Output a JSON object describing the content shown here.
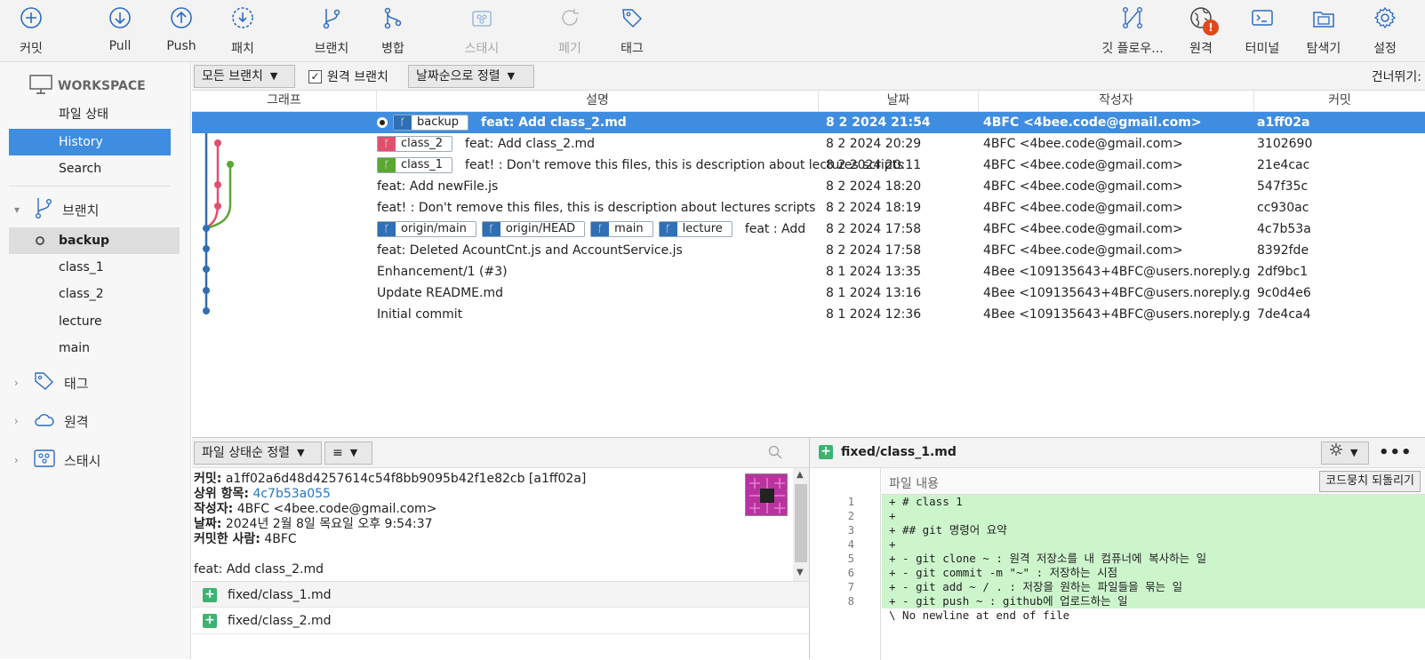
{
  "toolbar": {
    "commit": "커밋",
    "pull": "Pull",
    "push": "Push",
    "patch": "패치",
    "branch": "브랜치",
    "merge": "병합",
    "stash": "스태시",
    "discard": "폐기",
    "tag": "태그",
    "gitflow": "깃 플로우...",
    "remote": "원격",
    "terminal": "터미널",
    "explorer": "탐색기",
    "settings": "설정",
    "remote_badge": "!"
  },
  "sidebar": {
    "workspace": "WORKSPACE",
    "workspace_items": [
      "파일 상태",
      "History",
      "Search"
    ],
    "branches_label": "브랜치",
    "branches": [
      "backup",
      "class_1",
      "class_2",
      "lecture",
      "main"
    ],
    "tags_label": "태그",
    "remotes_label": "원격",
    "stashes_label": "스태시"
  },
  "filterbar": {
    "all_branches": "모든 브랜치",
    "remote_branches": "원격 브랜치",
    "sort_by_date": "날짜순으로 정렬",
    "skip": "건너뛰기:"
  },
  "table": {
    "headers": {
      "graph": "그래프",
      "description": "설명",
      "date": "날짜",
      "author": "작성자",
      "commit": "커밋"
    },
    "rows": [
      {
        "tags": [
          {
            "name": "backup",
            "color": "#2f6fb5"
          }
        ],
        "message": "feat: Add class_2.md",
        "date": "8 2 2024 21:54",
        "author": "4BFC <4bee.code@gmail.com>",
        "commit": "a1ff02a"
      },
      {
        "tags": [
          {
            "name": "class_2",
            "color": "#e0506e"
          }
        ],
        "message": "feat: Add class_2.md",
        "date": "8 2 2024 20:29",
        "author": "4BFC <4bee.code@gmail.com>",
        "commit": "3102690"
      },
      {
        "tags": [
          {
            "name": "class_1",
            "color": "#5aa832"
          }
        ],
        "message": "feat! : Don't remove this files, this is description about lectures scripts",
        "date": "8 2 2024 20:11",
        "author": "4BFC <4bee.code@gmail.com>",
        "commit": "21e4cac"
      },
      {
        "tags": [],
        "message": "feat: Add newFile.js",
        "date": "8 2 2024 18:20",
        "author": "4BFC <4bee.code@gmail.com>",
        "commit": "547f35c"
      },
      {
        "tags": [],
        "message": "feat! : Don't remove this files, this is description about lectures scripts",
        "date": "8 2 2024 18:19",
        "author": "4BFC <4bee.code@gmail.com>",
        "commit": "cc930ac"
      },
      {
        "tags": [
          {
            "name": "origin/main",
            "color": "#2f6fb5"
          },
          {
            "name": "origin/HEAD",
            "color": "#2f6fb5"
          },
          {
            "name": "main",
            "color": "#2f6fb5"
          },
          {
            "name": "lecture",
            "color": "#2f6fb5"
          }
        ],
        "message": "feat : Add",
        "date": "8 2 2024 17:58",
        "author": "4BFC <4bee.code@gmail.com>",
        "commit": "4c7b53a"
      },
      {
        "tags": [],
        "message": "feat: Deleted AcountCnt.js and AccountService.js",
        "date": "8 2 2024 17:58",
        "author": "4BFC <4bee.code@gmail.com>",
        "commit": "8392fde"
      },
      {
        "tags": [],
        "message": "Enhancement/1 (#3)",
        "date": "8 1 2024 13:35",
        "author": "4Bee <109135643+4BFC@users.noreply.github.com>",
        "commit": "2df9bc1"
      },
      {
        "tags": [],
        "message": "Update README.md",
        "date": "8 1 2024 13:16",
        "author": "4Bee <109135643+4BFC@users.noreply.github.com>",
        "commit": "9c0d4e6"
      },
      {
        "tags": [],
        "message": "Initial commit",
        "date": "8 1 2024 12:36",
        "author": "4Bee <109135643+4BFC@users.noreply.github.com>",
        "commit": "7de4ca4"
      }
    ]
  },
  "details": {
    "sort_label": "파일 상태순 정렬",
    "list_icon": "≡",
    "commit_label": "커밋:",
    "commit_value": "a1ff02a6d48d4257614c54f8bb9095b42f1e82cb [a1ff02a]",
    "parent_label": "상위 항목:",
    "parent_value": "4c7b53a055",
    "author_label": "작성자:",
    "author_value": "4BFC <4bee.code@gmail.com>",
    "date_label": "날짜:",
    "date_value": "2024년 2월 8일 목요일 오후 9:54:37",
    "committer_label": "커밋한 사람:",
    "committer_value": "4BFC",
    "message": "feat: Add class_2.md",
    "files": [
      "fixed/class_1.md",
      "fixed/class_2.md"
    ]
  },
  "diff": {
    "file": "fixed/class_1.md",
    "content_label": "파일 내용",
    "reverse_hunk": "코드뭉치 되돌리기",
    "lines": [
      {
        "n": "1",
        "text": "+ # class 1"
      },
      {
        "n": "2",
        "text": "+"
      },
      {
        "n": "3",
        "text": "+ ## git 명령어 요약"
      },
      {
        "n": "4",
        "text": "+"
      },
      {
        "n": "5",
        "text": "+ - git clone ~ : 원격 저장소를 내 컴퓨너에 복사하는 일"
      },
      {
        "n": "6",
        "text": "+ - git commit -m \"~\" : 저장하는 시점"
      },
      {
        "n": "7",
        "text": "+ - git add ~ / . : 저장을 원하는 파일들을 묶는 일"
      },
      {
        "n": "8",
        "text": "+ - git push ~ : github에 업로드하는 일"
      }
    ],
    "no_newline": "\\ No newline at end of file"
  },
  "colors": {
    "selection": "#3f8de0",
    "add_bg": "#ccf5cc",
    "branch_blue": "#2f6fb5",
    "branch_red": "#e0506e",
    "branch_green": "#5aa832"
  }
}
